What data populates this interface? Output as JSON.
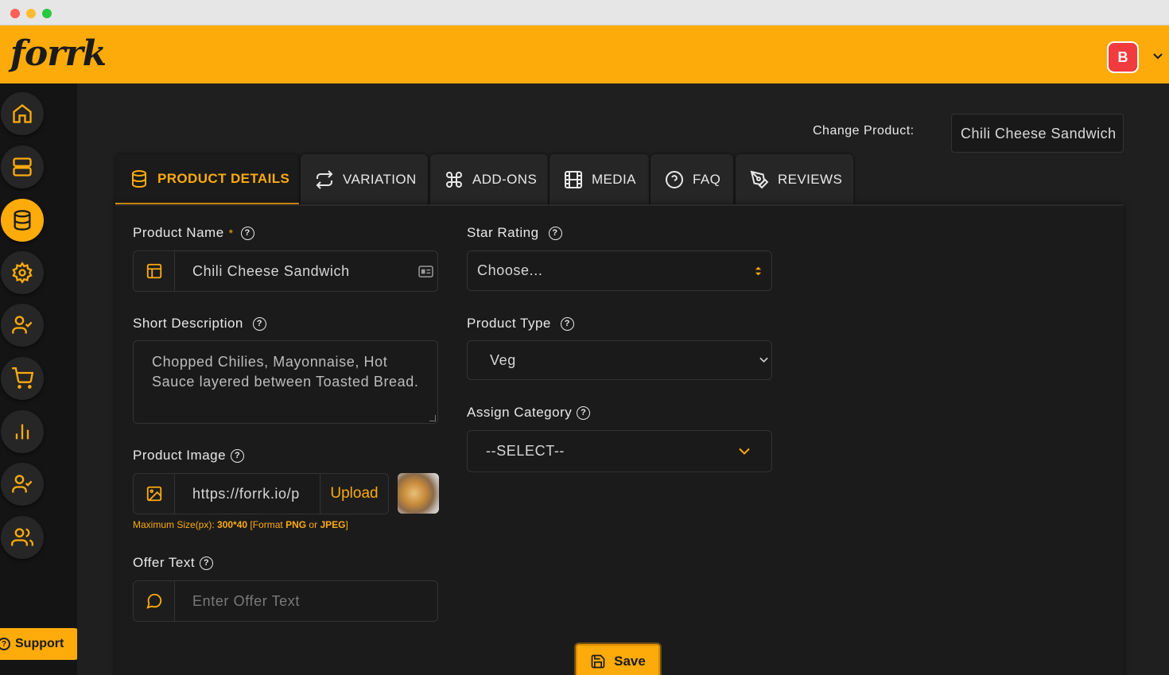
{
  "app": {
    "logo": "forrk",
    "user_initial": "B"
  },
  "sidebar": {
    "items": [
      {
        "icon": "home-icon"
      },
      {
        "icon": "server-icon"
      },
      {
        "icon": "database-icon",
        "active": true
      },
      {
        "icon": "gear-icon"
      },
      {
        "icon": "user-check-icon"
      },
      {
        "icon": "cart-icon"
      },
      {
        "icon": "bar-chart-icon"
      },
      {
        "icon": "user-check-icon"
      },
      {
        "icon": "users-icon"
      }
    ],
    "support_label": "Support",
    "support_q": "?"
  },
  "header": {
    "change_product_label": "Change Product:",
    "change_product_value": "Chili Cheese Sandwich"
  },
  "tabs": [
    {
      "label": "PRODUCT DETAILS",
      "icon": "database-icon",
      "active": true
    },
    {
      "label": "VARIATION",
      "icon": "repeat-icon"
    },
    {
      "label": "ADD-ONS",
      "icon": "command-icon"
    },
    {
      "label": "MEDIA",
      "icon": "film-icon"
    },
    {
      "label": "FAQ",
      "icon": "question-circle-icon"
    },
    {
      "label": "REVIEWS",
      "icon": "pen-tool-icon"
    }
  ],
  "form": {
    "product_name": {
      "label": "Product Name",
      "required_mark": "*",
      "value": "Chili Cheese Sandwich"
    },
    "short_description": {
      "label": "Short Description",
      "value": "Chopped Chilies, Mayonnaise, Hot Sauce layered between Toasted Bread."
    },
    "product_image": {
      "label": "Product Image",
      "value": "https://forrk.io/p",
      "upload_label": "Upload",
      "hint_prefix": "Maximum Size(px): ",
      "hint_size": "300*40",
      "hint_mid": " [Format ",
      "hint_png": "PNG",
      "hint_or": " or ",
      "hint_jpeg": "JPEG",
      "hint_end": "]"
    },
    "offer_text": {
      "label": "Offer Text",
      "placeholder": "Enter Offer Text"
    },
    "star_rating": {
      "label": "Star Rating",
      "value": "Choose..."
    },
    "product_type": {
      "label": "Product Type",
      "value": "Veg"
    },
    "assign_category": {
      "label": "Assign Category",
      "value": "--SELECT--"
    },
    "help_glyph": "?"
  },
  "actions": {
    "save_label": "Save"
  },
  "colors": {
    "accent": "#fdab0b",
    "background": "#1f1f1f",
    "avatar": "#f13b3f"
  }
}
